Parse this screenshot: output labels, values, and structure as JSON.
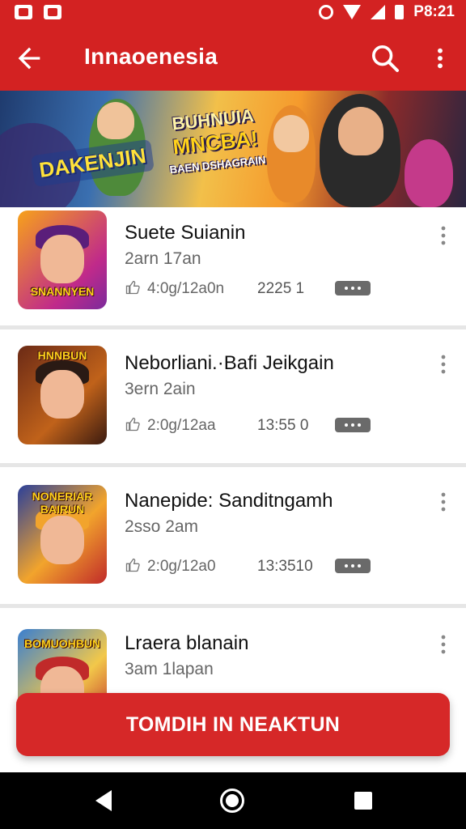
{
  "status_bar": {
    "time": "P8:21",
    "icons": [
      "app-icon",
      "app-icon",
      "alarm-icon",
      "wifi-icon",
      "signal-icon",
      "battery-icon"
    ]
  },
  "app_bar": {
    "title": "Innaoenesia",
    "back_icon": "arrow-left-icon",
    "search_icon": "search-icon",
    "more_icon": "more-vert-icon"
  },
  "banner": {
    "title_line1": "BUHNUIA",
    "title_line2": "MNCBA!",
    "title_line3": "BAEN DSHAGRAIN",
    "logo": "DAKENJIN"
  },
  "items": [
    {
      "title": "Suete Suianin",
      "subtitle": "2arn 17an",
      "size": "4:0g/12a0n",
      "count": "2225 1",
      "thumb_text": "SNANNYEN",
      "colors": [
        "#f7a21a",
        "#7b2a9c"
      ]
    },
    {
      "title": "Neborliani.·Bafi Jeikgain",
      "subtitle": "3ern 2ain",
      "size": "2:0g/12aa",
      "count": "13:55 0",
      "thumb_text": "HNNBUN",
      "colors": [
        "#4a1c12",
        "#c0621a"
      ]
    },
    {
      "title": "Nanepide: Sanditngamh",
      "subtitle": "2sso 2am",
      "size": "2:0g/12a0",
      "count": "13:3510",
      "thumb_text": "NONERIAR BAIRUN",
      "colors": [
        "#2a3f9a",
        "#f2a42c"
      ]
    },
    {
      "title": "Lraera blanain",
      "subtitle": "3am 1lapan",
      "size": "",
      "count": "",
      "thumb_text": "BOMUOHBUN",
      "colors": [
        "#3a7fd0",
        "#f2c84a"
      ]
    }
  ],
  "cta": {
    "label": "TOMDIH IN NEAKTUN"
  },
  "nav_bar": {
    "icons": [
      "nav-back-icon",
      "nav-home-icon",
      "nav-recents-icon"
    ]
  },
  "theme": {
    "primary": "#d32222",
    "divider": "#e6e6e6",
    "badge": "#6a6a6a"
  }
}
